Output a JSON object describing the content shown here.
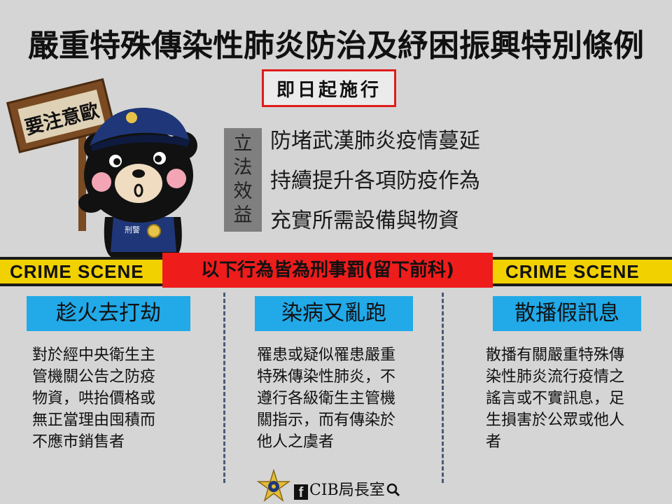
{
  "title": "嚴重特殊傳染性肺炎防治及紓困振興特別條例",
  "effective": "即日起施行",
  "sign_text": "要注意歐",
  "vest_text": "刑警",
  "legislative_benefits": {
    "label": [
      "立",
      "法",
      "效",
      "益"
    ],
    "items": [
      "防堵武漢肺炎疫情蔓延",
      "持續提升各項防疫作為",
      "充實所需設備與物資"
    ]
  },
  "tape_text": "CRIME SCENE",
  "banner": "以下行為皆為刑事罰(留下前科)",
  "categories": [
    {
      "title": "趁火去打劫",
      "lines": [
        "對於經中央衛生主",
        "管機關公告之防疫",
        "物資，哄抬價格或",
        "無正當理由囤積而",
        "不應市銷售者"
      ]
    },
    {
      "title": "染病又亂跑",
      "lines": [
        "罹患或疑似罹患嚴重",
        "特殊傳染性肺炎，不",
        "遵行各級衛生主管機",
        "關指示，而有傳染於",
        "他人之虞者"
      ]
    },
    {
      "title": "散播假訊息",
      "lines": [
        "散播有關嚴重特殊傳",
        "染性肺炎流行疫情之",
        "謠言或不實訊息，足",
        "生損害於公眾或他人",
        "者"
      ]
    }
  ],
  "footer": {
    "fb_glyph": "f",
    "label": "CIB局長室"
  },
  "colors": {
    "background": "#d5d5d5",
    "banner_red": "#ef1c1c",
    "category_blue": "#21a9e8",
    "tape_yellow": "#f2d100",
    "label_gray": "#7f7f7f"
  }
}
